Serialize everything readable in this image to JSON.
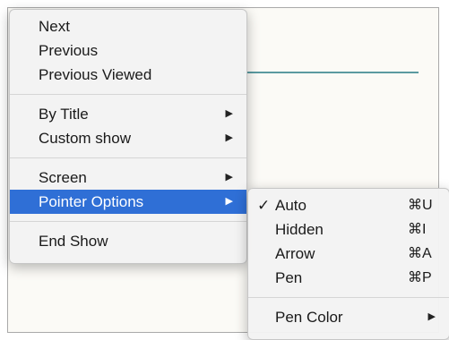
{
  "main_menu": {
    "group1": [
      "Next",
      "Previous",
      "Previous Viewed"
    ],
    "group2": [
      {
        "label": "By Title",
        "arrow": "▶"
      },
      {
        "label": "Custom show",
        "arrow": "▶"
      }
    ],
    "group3": [
      {
        "label": "Screen",
        "arrow": "▶"
      },
      {
        "label": "Pointer Options",
        "arrow": "▶"
      }
    ],
    "group4": [
      "End Show"
    ]
  },
  "sub_menu": {
    "checkmark": "✓",
    "items": [
      {
        "label": "Auto",
        "shortcut": "⌘U"
      },
      {
        "label": "Hidden",
        "shortcut": "⌘I"
      },
      {
        "label": "Arrow",
        "shortcut": "⌘A"
      },
      {
        "label": "Pen",
        "shortcut": "⌘P"
      }
    ],
    "pen_color": {
      "label": "Pen Color",
      "arrow": "▶"
    }
  },
  "colors": {
    "highlight": "#2f6fd6",
    "slide_line": "#5a9aa0"
  }
}
